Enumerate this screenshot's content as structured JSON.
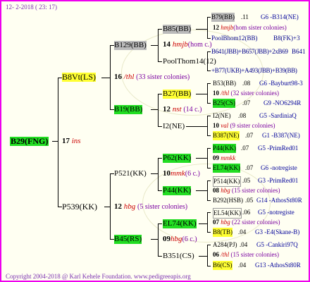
{
  "header": {
    "date": "12-  2-2018 ( 23: 17)"
  },
  "footer": {
    "copyright": "Copyright 2004-2018 @ Karl Kehele Foundation.",
    "url": "www.pedigreeapis.org"
  },
  "root": {
    "name": "B29(FNG)",
    "year": "17",
    "mark": "ins"
  },
  "p1": {
    "name": "B8Vt(LS)",
    "year": "16",
    "mark": "/thl",
    "sisters": "(33 sister colonies)"
  },
  "p2": {
    "name": "P539(KK)",
    "year": "12",
    "mark": "hbg",
    "sisters": "(5 sister colonies)"
  },
  "g1": {
    "name": "B129(BB)"
  },
  "g2": {
    "name": "B19(BB)"
  },
  "g3": {
    "name": "P521(KK)",
    "year": "10",
    "mark": "mmk",
    "sisters": "(6 c.)"
  },
  "g4": {
    "name": "B45(RS)",
    "year": "09",
    "mark": "hbg",
    "sisters": "(6 c.)"
  },
  "gg1": {
    "name": "B85(BB)",
    "year": "14",
    "mark": "hmjb",
    "sisters": "(hom c.)"
  },
  "gg2": {
    "name": "PoolThom14(12)"
  },
  "gg3": {
    "name": "B27(BB)",
    "year": "12",
    "mark": "nst",
    "sisters": "(14 c.)"
  },
  "gg4": {
    "name": "I2(NE)"
  },
  "gg5": {
    "name": "P62(KK)"
  },
  "gg6": {
    "name": "P44(KK)"
  },
  "gg7": {
    "name": "EL74(KK)"
  },
  "gg8": {
    "name": "B351(CS)"
  },
  "leaves": [
    {
      "a": "B79(BB)",
      "b": ".11",
      "c": "G6 -B314(NE)"
    },
    {
      "a": "12",
      "m": "hmjb",
      "c": "(hom sister colonies)"
    },
    {
      "a": "PoolBhom12(BB)",
      "b": "",
      "c": "B8(FK)+3"
    },
    {
      "a": "B641(JBB)+B657(JBB)+2xB69",
      "b": "",
      "c": "B641"
    },
    {
      "a": "+B77(UKB)+A493(JBB)+B39(BB)",
      "b": "",
      "c": ""
    },
    {
      "a": "B53(BB)",
      "b": ".08",
      "c": "G6 -Bayburt98-3"
    },
    {
      "a": "10",
      "m": "/thl",
      "c": "(32 sister colonies)"
    },
    {
      "a": "B25(CS)",
      "b": ".07",
      "c": "G9 -NO6294R"
    },
    {
      "a": "I2(NE)",
      "b": ".08",
      "c": "G5 -SardiniaQ"
    },
    {
      "a": "10",
      "m": "val",
      "c": "(9 sister colonies)"
    },
    {
      "a": "B387(NE)",
      "b": ".07",
      "c": "G1 -B387(NE)"
    },
    {
      "a": "P44(KK)",
      "b": ".07",
      "c": "G5 -PrimRed01"
    },
    {
      "a": "09",
      "m": "mmkk",
      "c": ""
    },
    {
      "a": "EL74(KK)",
      "b": ".07",
      "c": "G6 -notregiste"
    },
    {
      "a": "P514(KK)",
      "b": ".05",
      "c": "G3 -PrimRed01"
    },
    {
      "a": "08",
      "m": "hbg",
      "c": "(15 sister colonies)"
    },
    {
      "a": "B292(HSB)",
      "b": ".05",
      "c": "G14 -AthosSt80R"
    },
    {
      "a": "EL54(KK)",
      "b": ".06",
      "c": "G5 -notregiste"
    },
    {
      "a": "07",
      "m": "hbg",
      "c": "(22 sister colonies)"
    },
    {
      "a": "B8(TB)",
      "b": ".04",
      "c": "G3 -E4(Skane-B)"
    },
    {
      "a": "A284(PJ)",
      "b": ".04",
      "c": "G5 -Cankiri97Q"
    },
    {
      "a": "06",
      "m": "/thl",
      "c": "(15 sister colonies)"
    },
    {
      "a": "B6(CS)",
      "b": ".04",
      "c": "G13 -AthosSt80R"
    }
  ]
}
